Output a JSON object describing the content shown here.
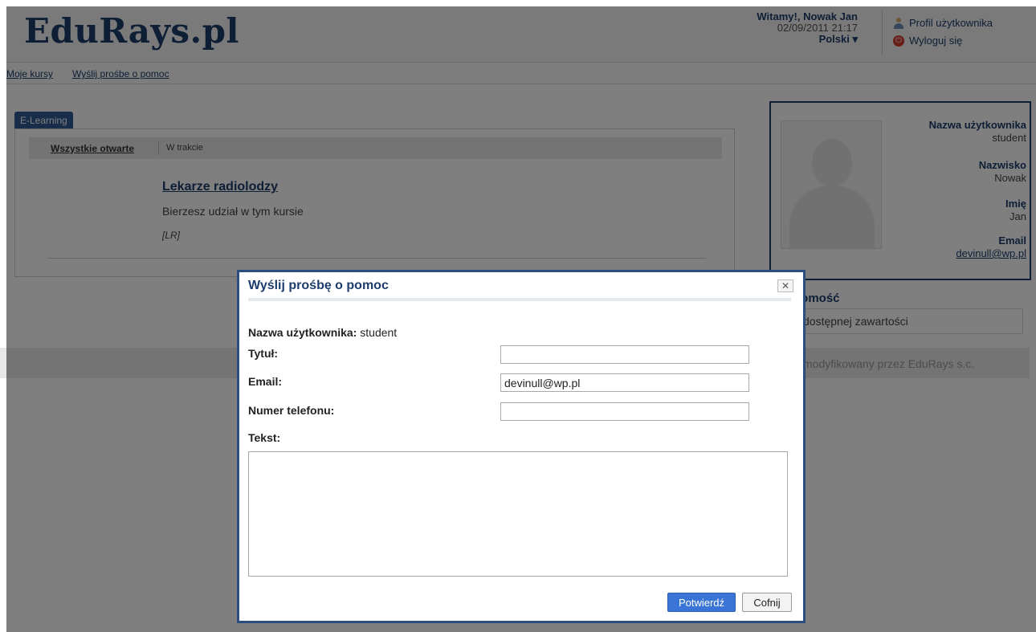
{
  "header": {
    "logo": "EduRays.pl",
    "greeting": "Witamy!, Nowak Jan",
    "datetime": "02/09/2011 21:17",
    "language": "Polski ▾",
    "profile_link": "Profil użytkownika",
    "logout_link": "Wyloguj się"
  },
  "nav": {
    "my_courses": "Moje kursy",
    "send_help": "Wyślij prośbe o pomoc"
  },
  "courses": {
    "tab": "E-Learning",
    "filter_all": "Wszystkie otwarte",
    "filter_in_progress": "W trakcie",
    "course_title": "Lekarze radiolodzy",
    "course_status": "Bierzesz udział w tym kursie",
    "course_code": "[LR]"
  },
  "profile": {
    "username_label": "Nazwa użytkownika",
    "username": "student",
    "surname_label": "Nazwisko",
    "surname": "Nowak",
    "name_label": "Imię",
    "name": "Jan",
    "email_label": "Email",
    "email": "devinull@wp.pl"
  },
  "message": {
    "title_partial": "domość",
    "text_partial": "dostępnej zawartości"
  },
  "footer": {
    "text_partial": "modyfikowany przez EduRays s.c."
  },
  "modal": {
    "title": "Wyślij prośbę o pomoc",
    "close": "✕",
    "username_label": "Nazwa użytkownika:",
    "username_value": "student",
    "title_label": "Tytuł:",
    "title_value": "",
    "email_label": "Email:",
    "email_value": "devinull@wp.pl",
    "phone_label": "Numer telefonu:",
    "phone_value": "",
    "text_label": "Tekst:",
    "text_value": "",
    "confirm_button": "Potwierdź",
    "cancel_button": "Cofnij"
  },
  "colors": {
    "brand": "#1c3d6b",
    "modal_border": "#2a4f7e",
    "confirm_button": "#3a74d6"
  }
}
